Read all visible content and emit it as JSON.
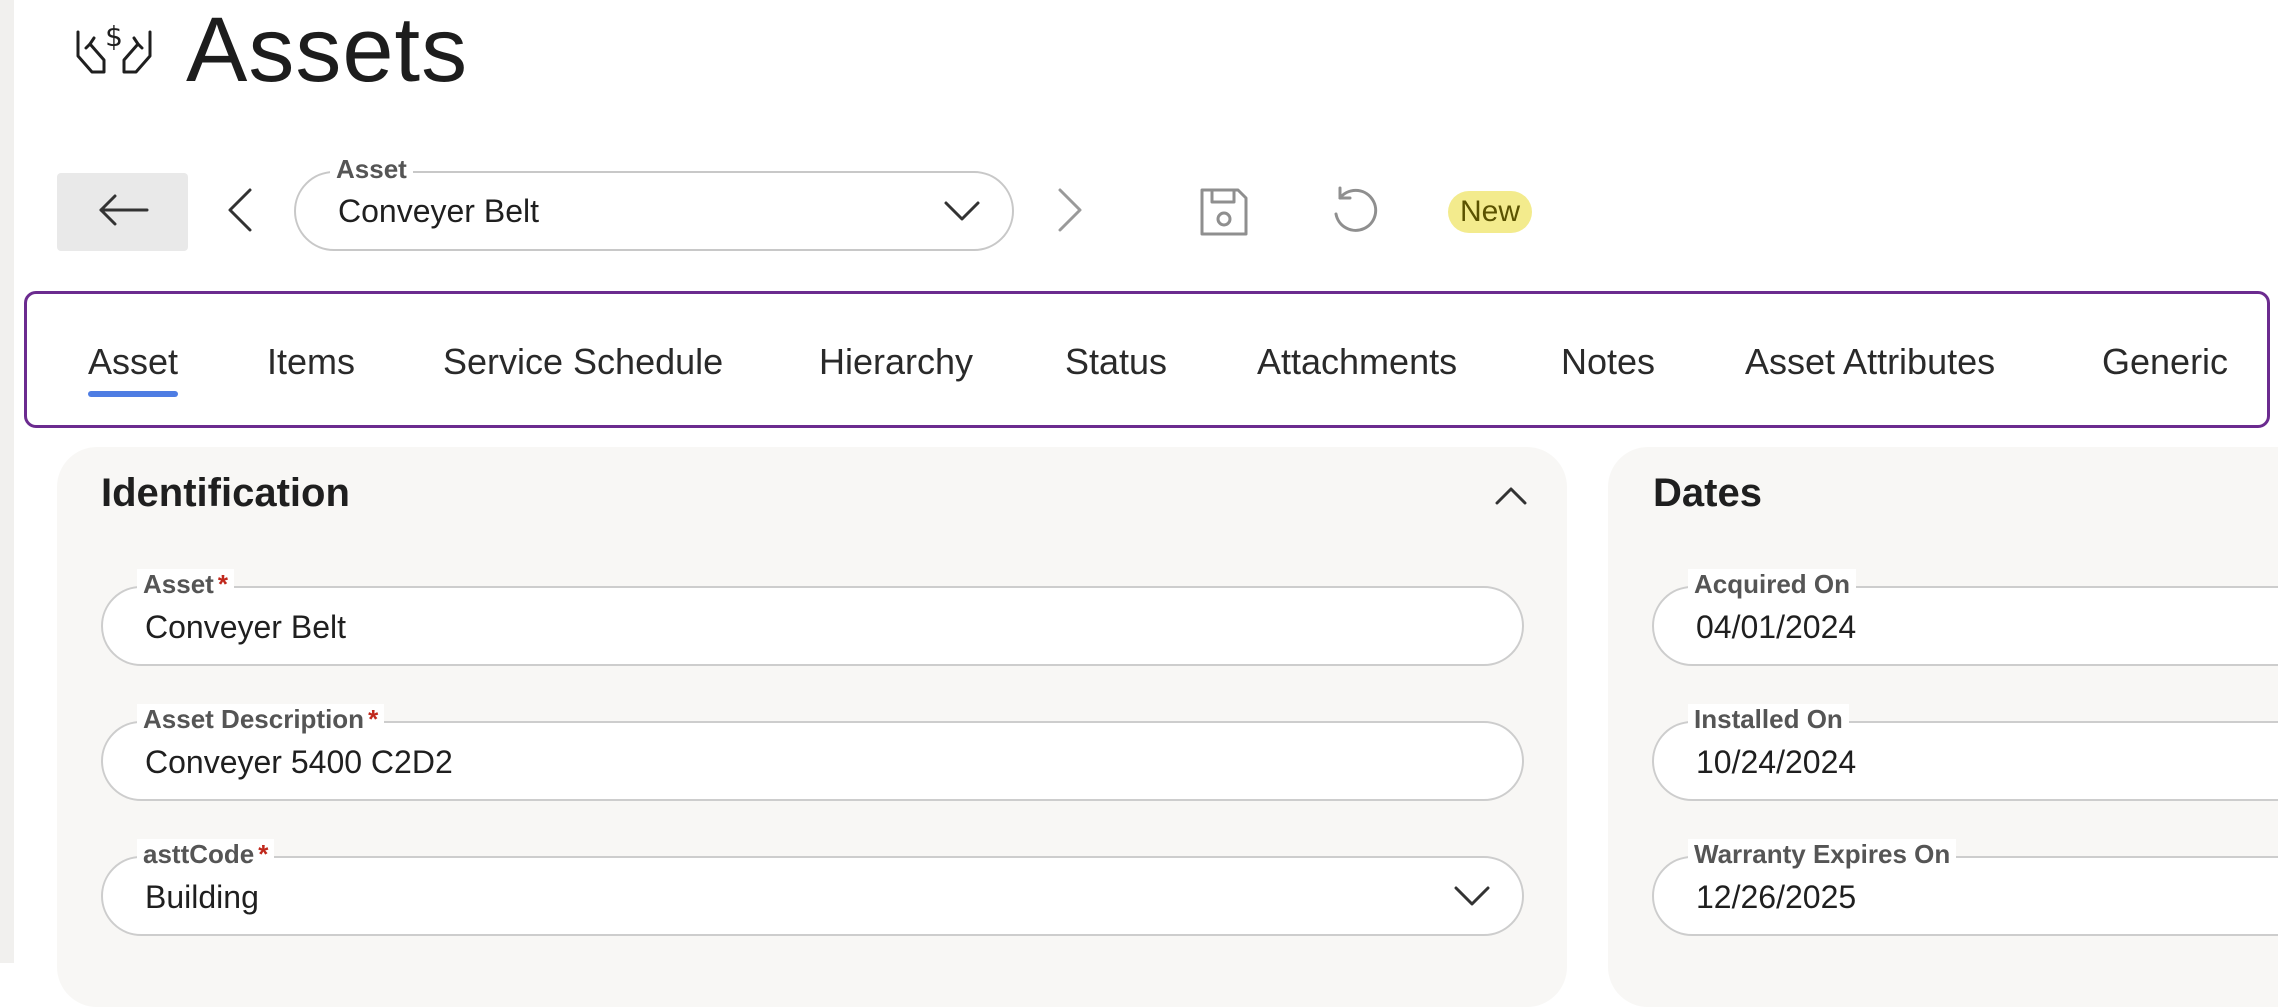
{
  "page": {
    "title": "Assets"
  },
  "toolbar": {
    "asset_label": "Asset",
    "asset_value": "Conveyer Belt",
    "status_badge": "New"
  },
  "tabs": [
    {
      "label": "Asset",
      "active": true
    },
    {
      "label": "Items"
    },
    {
      "label": "Service Schedule"
    },
    {
      "label": "Hierarchy"
    },
    {
      "label": "Status"
    },
    {
      "label": "Attachments"
    },
    {
      "label": "Notes"
    },
    {
      "label": "Asset Attributes"
    },
    {
      "label": "Generic"
    }
  ],
  "identification": {
    "title": "Identification",
    "fields": [
      {
        "label": "Asset",
        "required": "*",
        "value": "Conveyer Belt"
      },
      {
        "label": "Asset Description",
        "required": "*",
        "value": "Conveyer 5400 C2D2"
      },
      {
        "label": "asttCode",
        "required": "*",
        "value": "Building"
      }
    ]
  },
  "dates": {
    "title": "Dates",
    "fields": [
      {
        "label": "Acquired On",
        "value": "04/01/2024"
      },
      {
        "label": "Installed On",
        "value": "10/24/2024"
      },
      {
        "label": "Warranty Expires On",
        "value": "12/26/2025"
      }
    ]
  },
  "colors": {
    "accent": "#4e7de3",
    "tab_border": "#6b2b8f",
    "badge_bg": "#f3eb8d",
    "required": "#c0281c"
  },
  "icons": [
    "hands-dollar-icon",
    "arrow-left-icon",
    "chevron-left-icon",
    "chevron-down-icon",
    "chevron-right-icon",
    "save-icon",
    "undo-icon",
    "chevron-up-icon"
  ]
}
